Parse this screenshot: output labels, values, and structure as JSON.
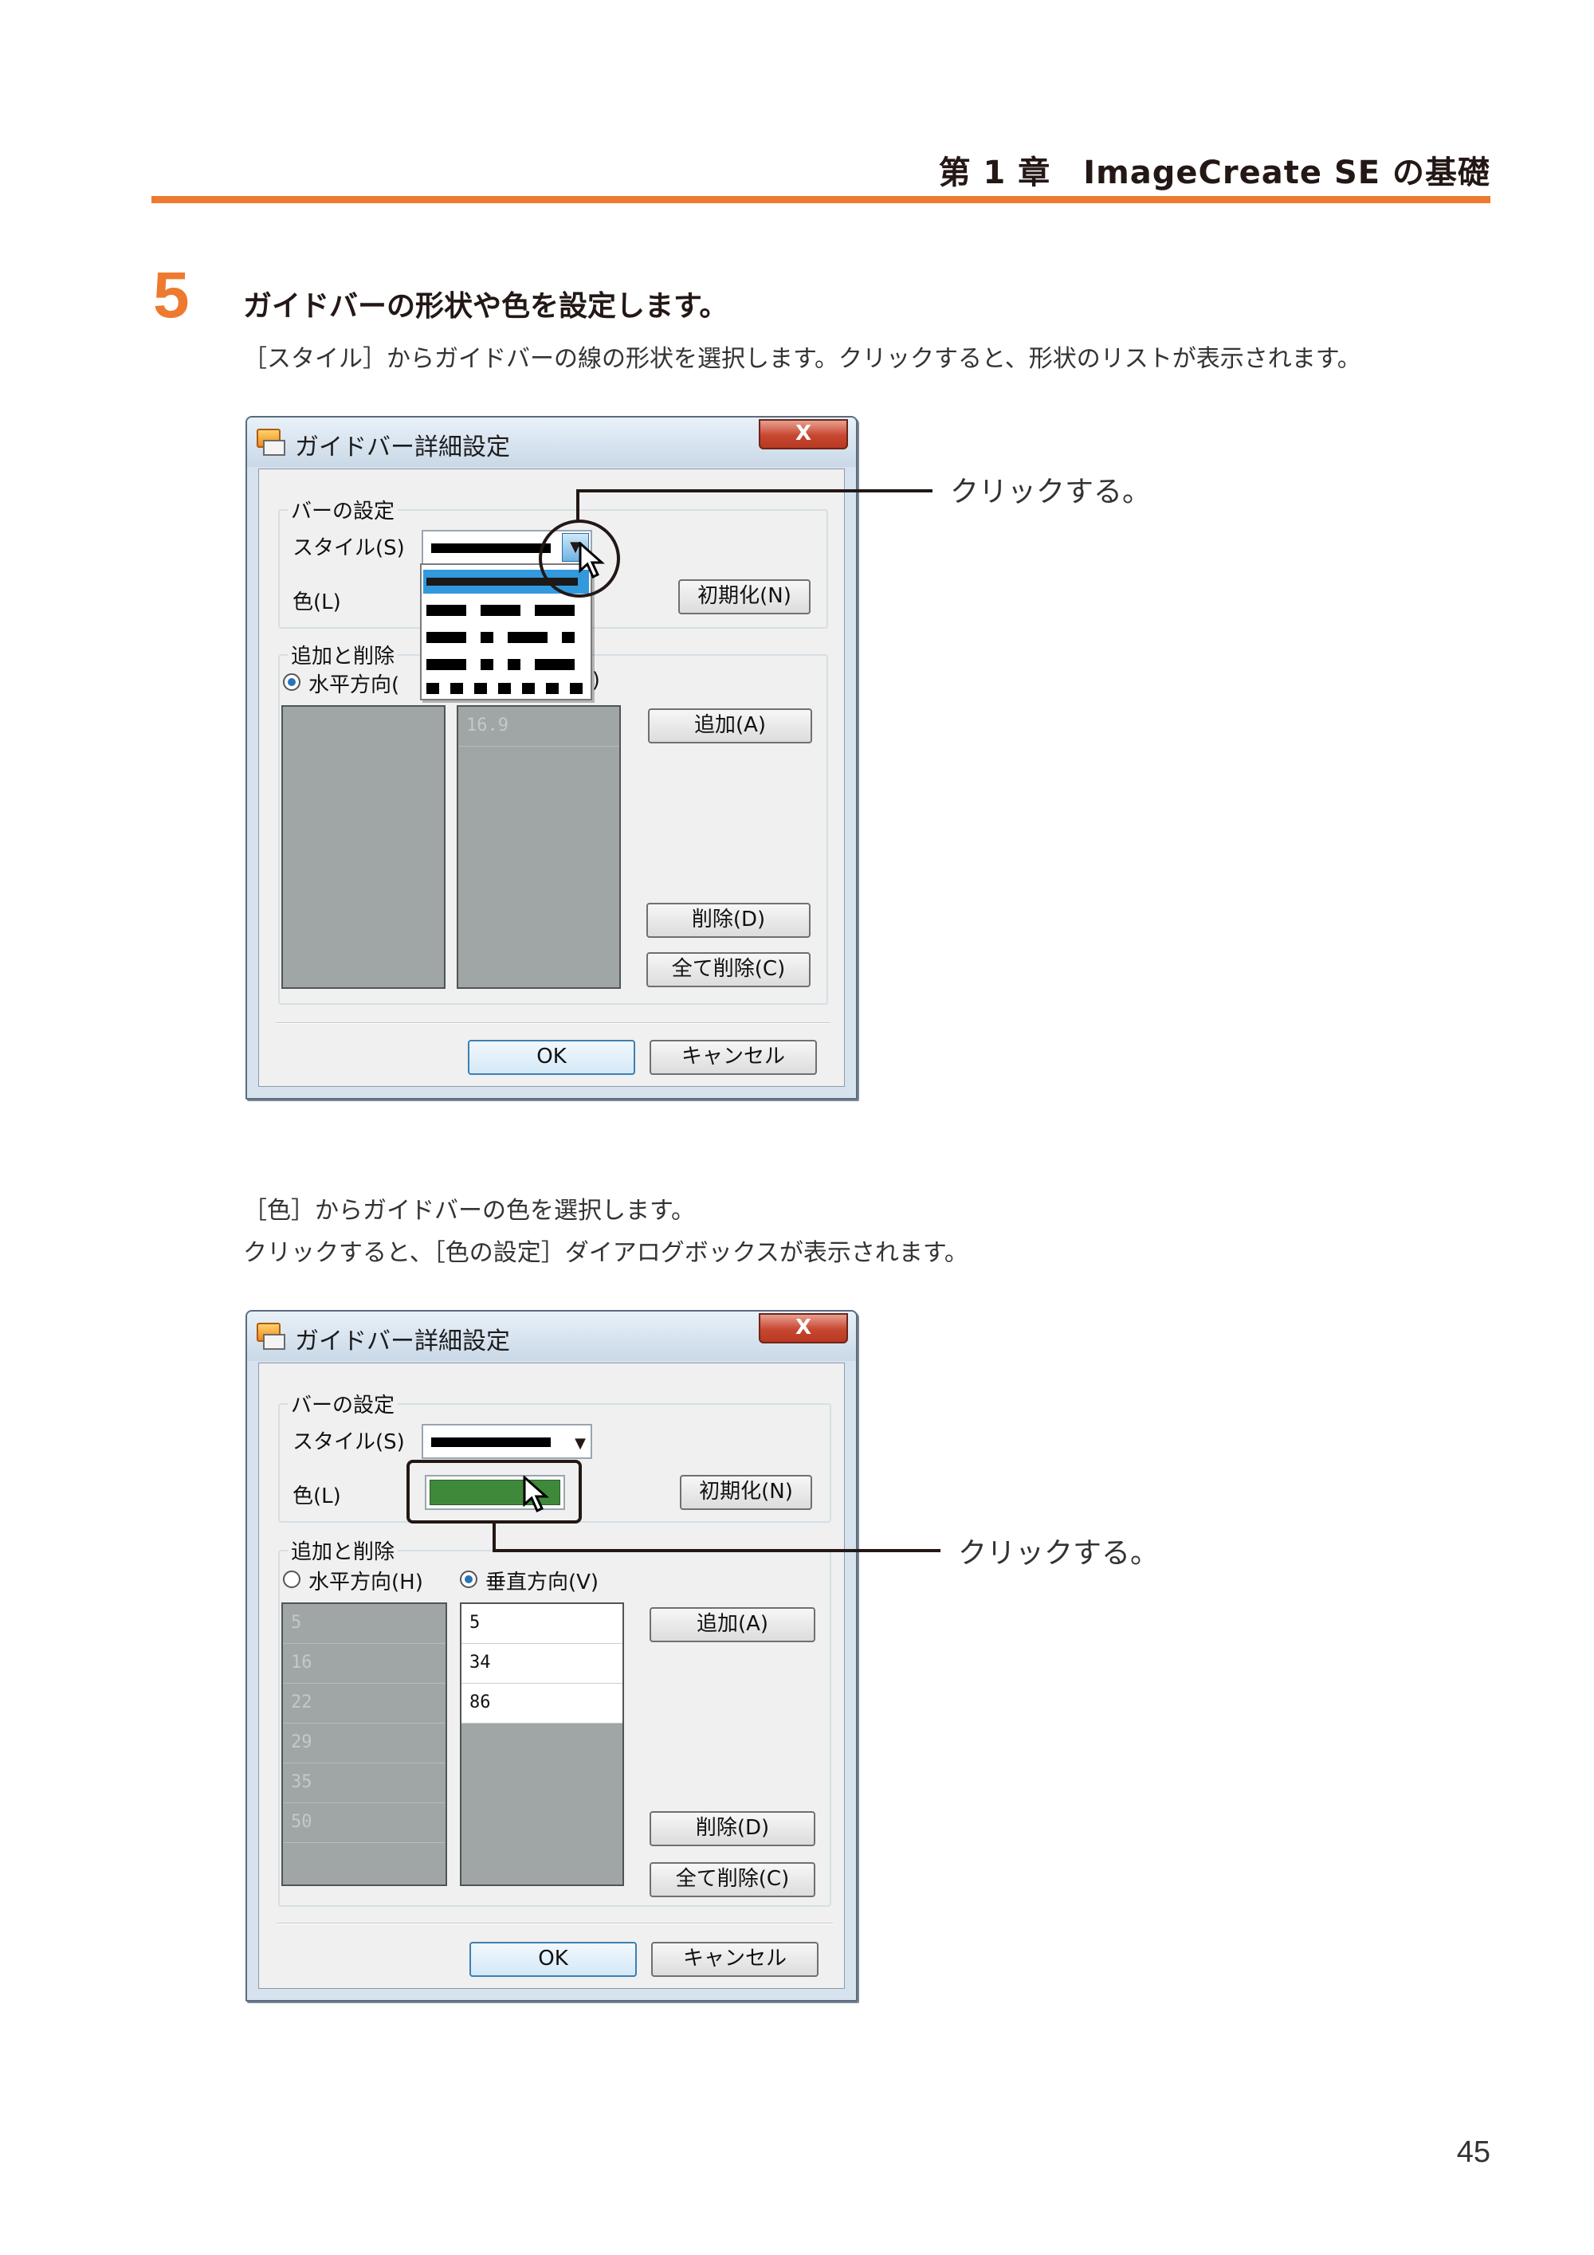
{
  "header": {
    "chapter_title": "第 1 章　ImageCreate SE の基礎"
  },
  "step": {
    "number": "5",
    "heading": "ガイドバーの形状や色を設定します。",
    "intro": "［スタイル］からガイドバーの線の形状を選択します。クリックすると、形状のリストが表示されます。",
    "second_line1": "［色］からガイドバーの色を選択します。",
    "second_line2": "クリックすると、［色の設定］ダイアログボックスが表示されます。"
  },
  "callouts": {
    "first": "クリックする。",
    "second": "クリックする。"
  },
  "dialog": {
    "title": "ガイドバー詳細設定",
    "close": "X",
    "bar_group": "バーの設定",
    "style_label": "スタイル(S)",
    "color_label": "色(L)",
    "reset_button": "初期化(N)",
    "add_delete_group": "追加と削除",
    "horizontal": "水平方向(H)",
    "vertical": "垂直方向(V)",
    "add_button": "追加(A)",
    "delete_button": "削除(D)",
    "delete_all_button": "全て削除(C)",
    "ok_button": "OK",
    "cancel_button": "キャンセル",
    "color_fill": "#3f8a3a"
  },
  "dialog1": {
    "horizontal_partial": "水平方向(",
    "vertical_partial": "V)",
    "vertical_list": [
      "16.9"
    ]
  },
  "dialog2": {
    "horizontal_list": [
      "5",
      "16",
      "22",
      "29",
      "35",
      "50"
    ],
    "vertical_list": [
      "5",
      "34",
      "86"
    ]
  },
  "page_number": "45",
  "colors": {
    "accent": "#ee7a2f"
  }
}
